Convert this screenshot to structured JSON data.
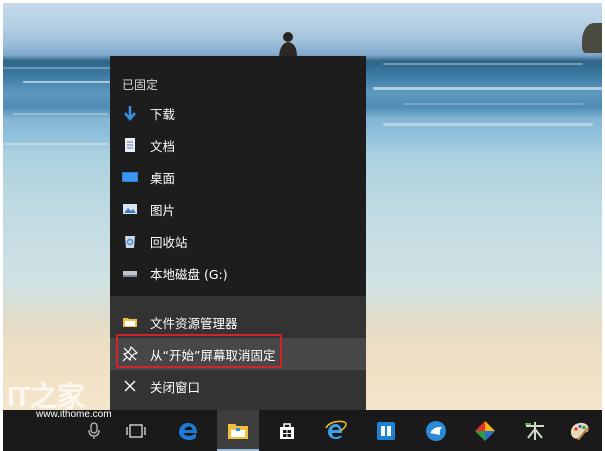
{
  "jumplist": {
    "pinned_header": "已固定",
    "pinned_items": [
      {
        "label": "下载",
        "icon": "download-arrow-icon"
      },
      {
        "label": "文档",
        "icon": "document-icon"
      },
      {
        "label": "桌面",
        "icon": "desktop-icon"
      },
      {
        "label": "图片",
        "icon": "pictures-icon"
      },
      {
        "label": "回收站",
        "icon": "recycle-bin-icon"
      },
      {
        "label": "本地磁盘 (G:)",
        "icon": "local-disk-icon"
      }
    ],
    "tasks": [
      {
        "label": "文件资源管理器",
        "icon": "file-explorer-icon"
      },
      {
        "label": "从“开始”屏幕取消固定",
        "icon": "unpin-icon"
      },
      {
        "label": "关闭窗口",
        "icon": "close-icon"
      }
    ]
  },
  "watermark": {
    "url": "www.ithome.com"
  },
  "taskbar": {
    "buttons": [
      "microphone-icon",
      "task-view-icon",
      "edge-icon",
      "file-explorer-icon",
      "store-icon",
      "internet-explorer-icon",
      "app-blue-icon",
      "bird-app-icon",
      "colorful-app-icon",
      "lettering-app-icon",
      "paint-app-icon"
    ]
  },
  "colors": {
    "menu_bg": "#1d1d1d",
    "menu_tasks_bg": "#333333",
    "highlight_frame": "#d1232a",
    "taskbar_bg": "#1a1a1a"
  }
}
